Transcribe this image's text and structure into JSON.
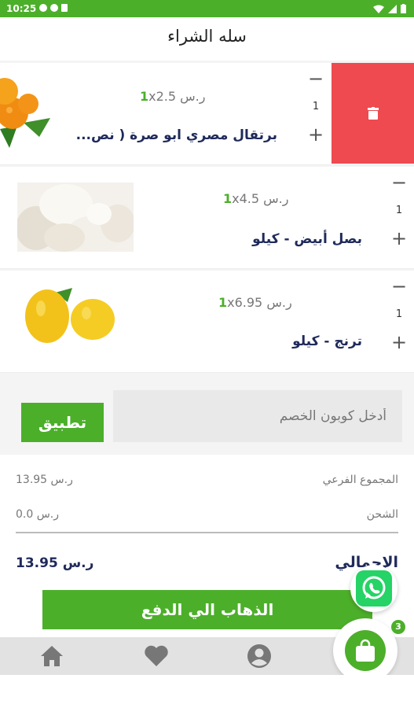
{
  "status_bar": {
    "time": "10:25"
  },
  "header": {
    "title": "سله الشراء"
  },
  "cart_items": [
    {
      "name": "برتقال مصري ابو صرة ( نص...",
      "unit_price": "x2.5 ر.س",
      "multiplier": "1",
      "quantity": "1",
      "image": "oranges"
    },
    {
      "name": "بصل أبيض - كيلو",
      "unit_price": "x4.5 ر.س",
      "multiplier": "1",
      "quantity": "1",
      "image": "white-onions"
    },
    {
      "name": "ترنج - كيلو",
      "unit_price": "x6.95 ر.س",
      "multiplier": "1",
      "quantity": "1",
      "image": "citron"
    }
  ],
  "coupon": {
    "placeholder": "أدخل كوبون الخصم",
    "apply_label": "تطبيق"
  },
  "totals": {
    "subtotal_label": "المجموع الفرعي",
    "subtotal_value": "13.95 ر.س",
    "shipping_label": "الشحن",
    "shipping_value": "0.0 ر.س",
    "total_label": "الإجمالي",
    "total_value": "13.95 ر.س"
  },
  "checkout": {
    "label": "الذهاب الي الدفع"
  },
  "cart_badge": "3",
  "colors": {
    "accent": "#4caf2a",
    "delete": "#ee4a4f",
    "text_dark": "#1f2a5a"
  },
  "icons": [
    "home-icon",
    "heart-icon",
    "user-icon",
    "whatsapp-icon",
    "shopping-bag-icon",
    "trash-icon"
  ]
}
